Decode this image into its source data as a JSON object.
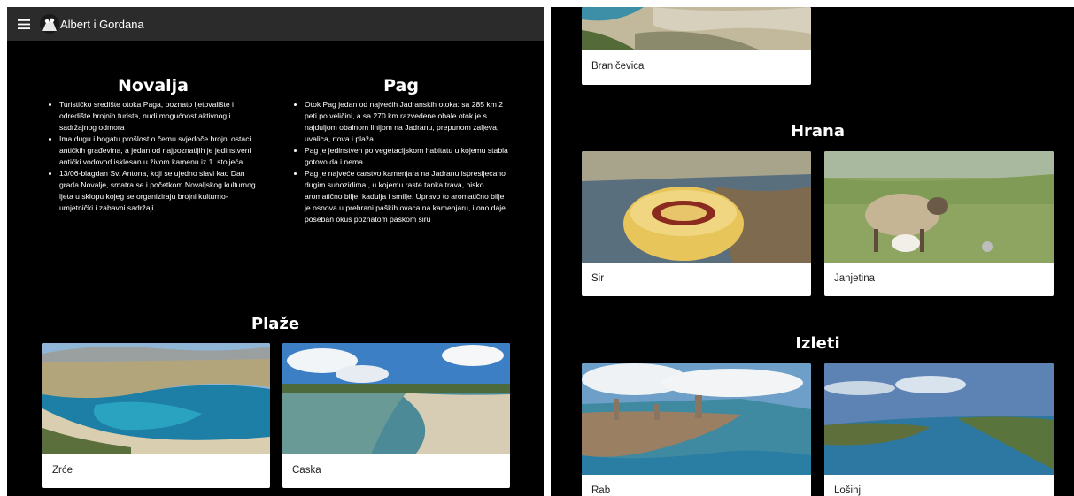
{
  "app": {
    "title": "Albert i Gordana"
  },
  "novalja": {
    "title": "Novalja",
    "bullets": [
      "Turističko središte otoka Paga, poznato ljetovalište i odredište brojnih turista, nudi mogućnost aktivnog i sadržajnog odmora",
      "Ima dugu i bogatu prošlost o čemu svjedoče brojni ostaci antičkih građevina, a jedan od najpoznatijih je jedinstveni antički vodovod isklesan u živom kamenu iz 1. stoljeća",
      "13/06-blagdan Sv. Antona, koji se ujedno slavi kao Dan grada Novalje, smatra se i početkom Novaljskog kulturnog ljeta u sklopu kojeg se organiziraju brojni kulturno-umjetnički i zabavni sadržaji"
    ]
  },
  "pag": {
    "title": "Pag",
    "bullets": [
      "Otok Pag jedan od najvećih Jadranskih otoka: sa 285 km 2 peti po veličini, a sa 270 km razvedene obale otok je s najduljom obalnom linijom na Jadranu, prepunom zaljeva, uvalica, rtova i plaža",
      "Pag je jedinstven po vegetacijskom habitatu u kojemu stabla gotovo da i nema",
      "Pag je najveće carstvo kamenjara na Jadranu ispresijecano dugim suhozidima , u kojemu raste tanka trava, nisko aromatično bilje, kadulja i smilje. Upravo to aromatično bilje je osnova u prehrani paških ovaca na kamenjaru, i ono daje poseban okus poznatom paškom siru"
    ]
  },
  "plaze": {
    "title": "Plaže",
    "cards": [
      {
        "label": "Zrće"
      },
      {
        "label": "Caska"
      }
    ]
  },
  "top_card": {
    "label": "Braničevica"
  },
  "hrana": {
    "title": "Hrana",
    "cards": [
      {
        "label": "Sir"
      },
      {
        "label": "Janjetina"
      }
    ]
  },
  "izleti": {
    "title": "Izleti",
    "cards": [
      {
        "label": "Rab"
      },
      {
        "label": "Lošinj"
      }
    ]
  },
  "icons": {
    "menu": "menu-icon",
    "logo": "logo-icon"
  }
}
